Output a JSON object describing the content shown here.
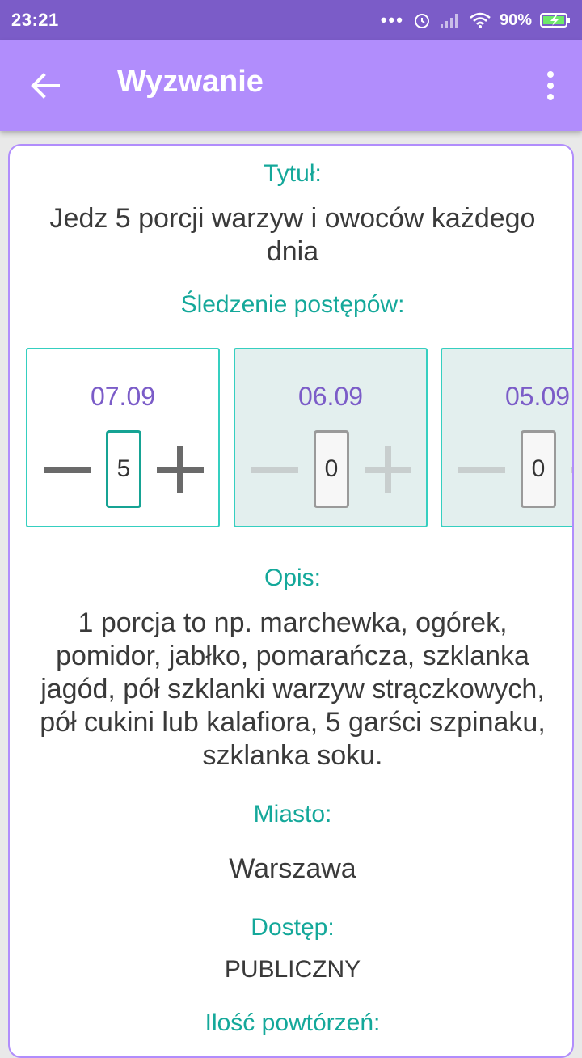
{
  "status": {
    "time": "23:21",
    "battery": "90%"
  },
  "appbar": {
    "title": "Wyzwanie"
  },
  "challenge": {
    "title_label": "Tytuł:",
    "title": "Jedz 5 porcji warzyw i owoców każdego dnia",
    "progress_label": "Śledzenie postępów:",
    "days": [
      {
        "date": "07.09",
        "count": "5"
      },
      {
        "date": "06.09",
        "count": "0"
      },
      {
        "date": "05.09",
        "count": "0"
      }
    ],
    "description_label": "Opis:",
    "description": "1 porcja to np. marchewka, ogórek, pomidor, jabłko, pomarańcza, szklanka jagód, pół szklanki warzyw strączkowych, pół cukini lub kalafiora, 5 garści szpinaku, szklanka soku.",
    "city_label": "Miasto:",
    "city": "Warszawa",
    "access_label": "Dostęp:",
    "access": "PUBLICZNY",
    "repeats_label": "Ilość powtórzeń:"
  }
}
